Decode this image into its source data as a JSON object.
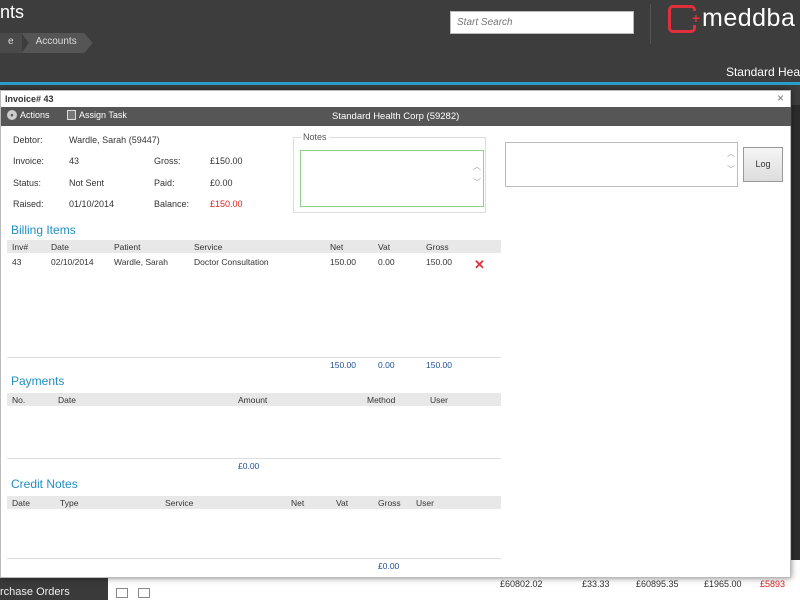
{
  "app": {
    "title_fragment": "nts",
    "breadcrumb": [
      "e",
      "Accounts"
    ],
    "search_placeholder": "Start Search",
    "logo_text": "meddba",
    "company_name": "Standard Hea",
    "purchase_orders_label": "rchase Orders",
    "background_row": [
      "£60802.02",
      "£33.33",
      "£60895.35",
      "£1965.00",
      "£5893"
    ]
  },
  "modal": {
    "title": "Invoice# 43",
    "close": "×",
    "toolbar": {
      "actions_label": "Actions",
      "assign_task_label": "Assign Task",
      "title": "Standard Health Corp (59282)"
    },
    "invoice": {
      "debtor_label": "Debtor:",
      "debtor_value": "Wardle, Sarah (59447)",
      "invoice_label": "Invoice:",
      "invoice_value": "43",
      "status_label": "Status:",
      "status_value": "Not Sent",
      "raised_label": "Raised:",
      "raised_value": "01/10/2014",
      "gross_label": "Gross:",
      "gross_value": "£150.00",
      "paid_label": "Paid:",
      "paid_value": "£0.00",
      "balance_label": "Balance:",
      "balance_value": "£150.00"
    },
    "notes_label": "Notes",
    "log_button": "Log",
    "billing_items": {
      "title": "Billing Items",
      "headers": [
        "Inv#",
        "Date",
        "Patient",
        "Service",
        "Net",
        "Vat",
        "Gross"
      ],
      "rows": [
        [
          "43",
          "02/10/2014",
          "Wardle, Sarah",
          "Doctor Consultation",
          "150.00",
          "0.00",
          "150.00"
        ]
      ],
      "totals": [
        "150.00",
        "0.00",
        "150.00"
      ]
    },
    "payments": {
      "title": "Payments",
      "headers": [
        "No.",
        "Date",
        "Amount",
        "Method",
        "User"
      ],
      "total": "£0.00"
    },
    "credit_notes": {
      "title": "Credit Notes",
      "headers": [
        "Date",
        "Type",
        "Service",
        "Net",
        "Vat",
        "Gross",
        "User"
      ],
      "total": "£0.00"
    }
  },
  "colors": {
    "accent": "#2aa0cf",
    "brand_red": "#e0303d",
    "negative": "#dd2222"
  }
}
